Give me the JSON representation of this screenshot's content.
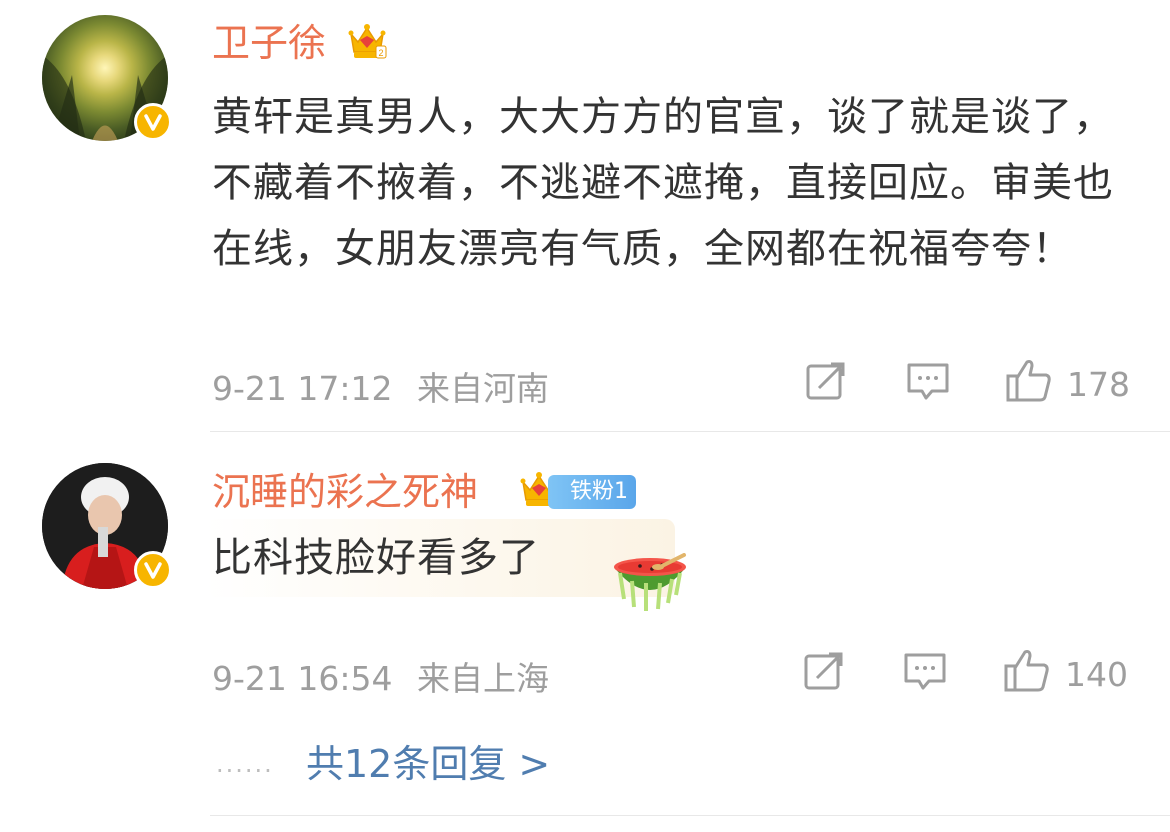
{
  "comments": [
    {
      "username": "卫子徐",
      "body": "黄轩是真男人，大大方方的官宣，谈了就是谈了，不藏着不掖着，不逃避不遮掩，直接回应。审美也在线，女朋友漂亮有气质，全网都在祝福夸夸！",
      "time": "9-21 17:12",
      "location": "来自河南",
      "likes": "178"
    },
    {
      "username": "沉睡的彩之死神",
      "fan_badge": "铁粉1",
      "body": "比科技脸好看多了",
      "time": "9-21 16:54",
      "location": "来自上海",
      "likes": "140",
      "replies": "共12条回复 >"
    }
  ],
  "icons": {
    "crown": "crown-icon",
    "verified": "verified-v-icon",
    "share": "share-icon",
    "comment": "comment-icon",
    "like": "thumbs-up-icon",
    "emoji": "watermelon-emoji-icon"
  },
  "colors": {
    "username": "#eb7350",
    "link": "#507daf",
    "meta": "#9e9e9e",
    "text": "#333333",
    "verified": "#f7b500"
  }
}
